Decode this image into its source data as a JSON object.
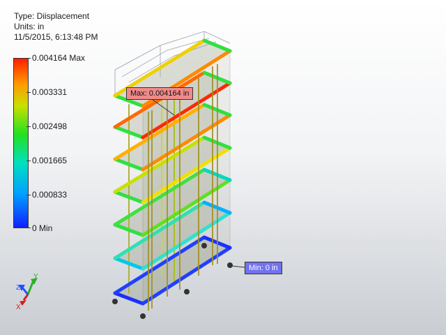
{
  "header": {
    "type_line": "Type: Diisplacement",
    "units_line": "Units: in",
    "timestamp_line": "11/5/2015, 6:13:48 PM"
  },
  "legend": {
    "max_label": "0.004164 Max",
    "label_2": "0.003331",
    "label_3": "0.002498",
    "label_4": "0.001665",
    "label_5": "0.000833",
    "min_label": "0 Min",
    "colors": [
      "#ff1e00",
      "#ff9a00",
      "#c8e000",
      "#22e022",
      "#00e0c0",
      "#00a0ff",
      "#1020ff"
    ]
  },
  "callouts": {
    "max_text": "Max: 0.004164 in",
    "min_text": "Min: 0 in"
  },
  "triad": {
    "z": "Z",
    "y": "Y",
    "x": "X"
  }
}
